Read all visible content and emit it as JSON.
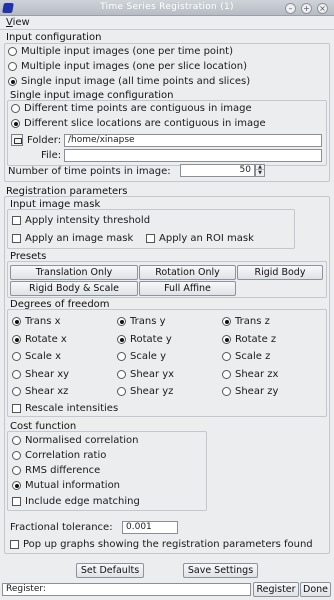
{
  "window": {
    "title": "Time Series Registration (1)",
    "menu_view": "View",
    "menu_view_mnemonic": "V",
    "menu_view_rest": "iew"
  },
  "input_config": {
    "label": "Input configuration",
    "options": [
      {
        "label": "Multiple input images (one per time point)",
        "selected": false
      },
      {
        "label": "Multiple input images (one per slice location)",
        "selected": false
      },
      {
        "label": "Single input image (all time points and slices)",
        "selected": true
      }
    ],
    "single": {
      "label": "Single input image configuration",
      "options": [
        {
          "label": "Different time points are contiguous in image",
          "selected": false
        },
        {
          "label": "Different slice locations are contiguous in image",
          "selected": true
        }
      ],
      "folder_label": "Folder:",
      "folder_value": "/home/xinapse",
      "file_label": "File:",
      "file_value": "",
      "ntp_label": "Number of time points in image:",
      "ntp_value": "50"
    }
  },
  "registration": {
    "label": "Registration parameters",
    "mask": {
      "label": "Input image mask",
      "apply_threshold": "Apply intensity threshold",
      "apply_image_mask": "Apply an image mask",
      "apply_roi_mask": "Apply an ROI mask"
    },
    "presets": {
      "label": "Presets",
      "buttons": [
        "Translation Only",
        "Rotation Only",
        "Rigid Body",
        "Rigid Body & Scale",
        "Full Affine"
      ]
    },
    "dof": {
      "label": "Degrees of freedom",
      "rows": [
        [
          {
            "label": "Trans x",
            "on": true
          },
          {
            "label": "Trans y",
            "on": true
          },
          {
            "label": "Trans z",
            "on": true
          }
        ],
        [
          {
            "label": "Rotate x",
            "on": true
          },
          {
            "label": "Rotate y",
            "on": true
          },
          {
            "label": "Rotate z",
            "on": true
          }
        ],
        [
          {
            "label": "Scale x",
            "on": false
          },
          {
            "label": "Scale y",
            "on": false
          },
          {
            "label": "Scale z",
            "on": false
          }
        ],
        [
          {
            "label": "Shear xy",
            "on": false
          },
          {
            "label": "Shear yx",
            "on": false
          },
          {
            "label": "Shear zx",
            "on": false
          }
        ],
        [
          {
            "label": "Shear xz",
            "on": false
          },
          {
            "label": "Shear yz",
            "on": false
          },
          {
            "label": "Shear zy",
            "on": false
          }
        ]
      ],
      "rescale": "Rescale intensities"
    },
    "cost": {
      "label": "Cost function",
      "options": [
        {
          "label": "Normalised correlation",
          "selected": false
        },
        {
          "label": "Correlation ratio",
          "selected": false
        },
        {
          "label": "RMS difference",
          "selected": false
        },
        {
          "label": "Mutual information",
          "selected": true
        }
      ],
      "edge": "Include edge matching"
    },
    "tolerance_label": "Fractional tolerance:",
    "tolerance_value": "0.001",
    "popup": "Pop up graphs showing the registration parameters found"
  },
  "footer": {
    "set_defaults": "Set Defaults",
    "save_settings": "Save Settings",
    "status_label": "Register:",
    "register": "Register",
    "done": "Done"
  },
  "icons": {
    "app": "app-icon",
    "minimize": "minimize-icon",
    "maximize": "maximize-icon",
    "close": "close-icon",
    "folder": "folder-icon"
  }
}
